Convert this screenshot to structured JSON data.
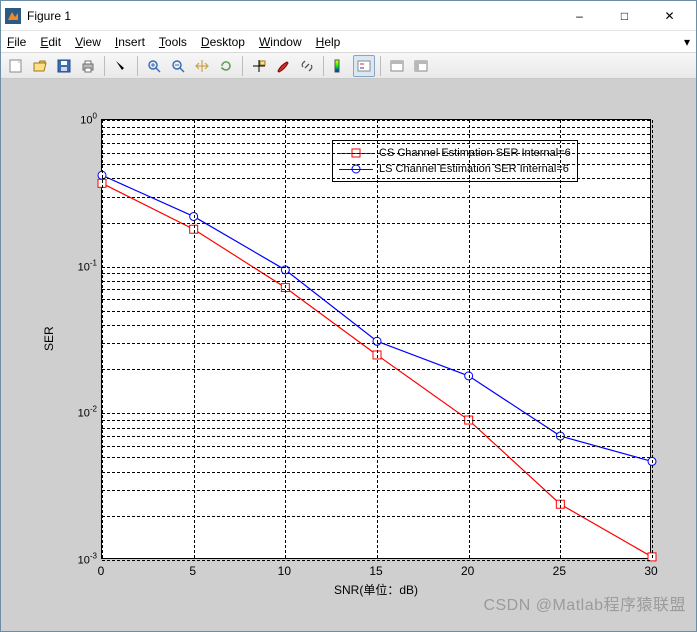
{
  "window": {
    "title": "Figure 1"
  },
  "menu": {
    "file": {
      "label": "File",
      "u": 0
    },
    "edit": {
      "label": "Edit",
      "u": 0
    },
    "view": {
      "label": "View",
      "u": 0
    },
    "insert": {
      "label": "Insert",
      "u": 0
    },
    "tools": {
      "label": "Tools",
      "u": 0
    },
    "desktop": {
      "label": "Desktop",
      "u": 0
    },
    "window": {
      "label": "Window",
      "u": 0
    },
    "help": {
      "label": "Help",
      "u": 0
    }
  },
  "toolbar": {
    "icons": [
      "new",
      "open",
      "save",
      "print",
      "arrow",
      "zoom-in",
      "zoom-out",
      "pan",
      "rotate",
      "datatip",
      "brush",
      "link",
      "colorbar",
      "legend",
      "insert-colorbar",
      "dock",
      "undock"
    ]
  },
  "chart_data": {
    "type": "line",
    "x": [
      0,
      5,
      10,
      15,
      20,
      25,
      30
    ],
    "xlim": [
      0,
      30
    ],
    "ylim": [
      0.001,
      1
    ],
    "yscale": "log",
    "xlabel": "SNR(单位：dB)",
    "ylabel": "SER",
    "xticks": [
      0,
      5,
      10,
      15,
      20,
      25,
      30
    ],
    "yticks": [
      0.001,
      0.01,
      0.1,
      1
    ],
    "yticklabels": [
      "10^{-3}",
      "10^{-2}",
      "10^{-1}",
      "10^{0}"
    ],
    "series": [
      {
        "name": "CS Channel Estimation SER Internal=6",
        "color": "#ff0000",
        "marker": "square",
        "values": [
          0.37,
          0.18,
          0.072,
          0.025,
          0.009,
          0.0024,
          0.00105
        ]
      },
      {
        "name": "LS Channel Estimation SER Internal=6",
        "color": "#0000ff",
        "marker": "circle",
        "values": [
          0.42,
          0.22,
          0.095,
          0.031,
          0.018,
          0.007,
          0.0047
        ]
      }
    ]
  },
  "watermark": "CSDN @Matlab程序猿联盟"
}
